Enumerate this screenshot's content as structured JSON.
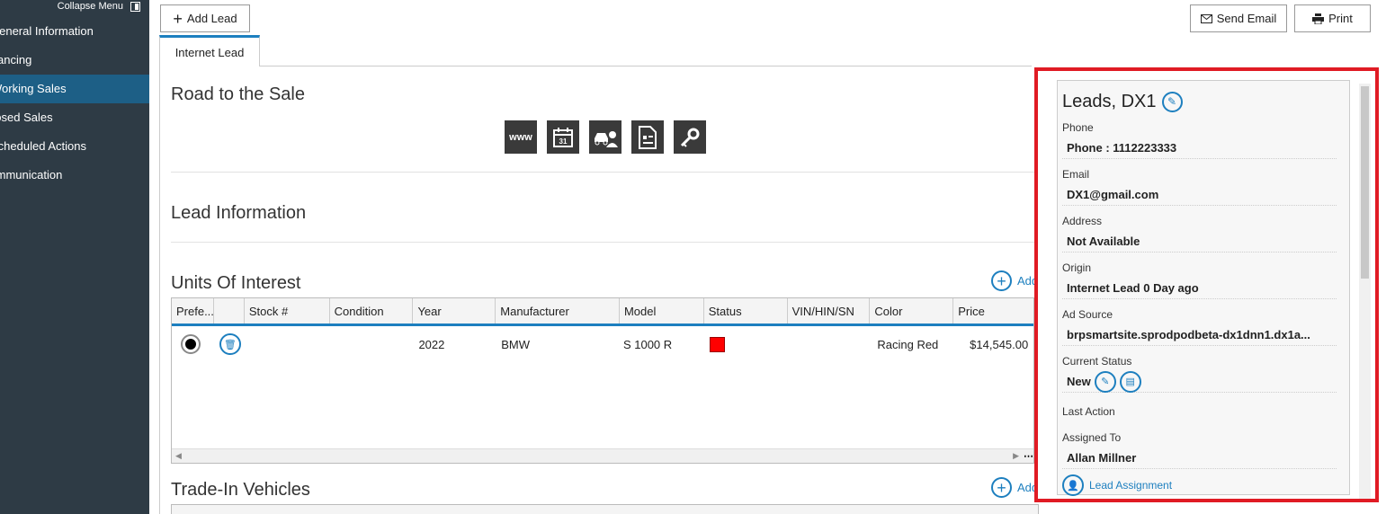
{
  "sidebar": {
    "collapse_label": "Collapse Menu",
    "items": [
      {
        "label": "General Information"
      },
      {
        "label": "Financing"
      },
      {
        "label": "Working Sales"
      },
      {
        "label": "Closed Sales"
      },
      {
        "label": "Scheduled Actions"
      },
      {
        "label": "Communication"
      }
    ]
  },
  "toolbar": {
    "add_lead": "Add Lead",
    "send_email": "Send Email",
    "print": "Print"
  },
  "tabs": {
    "internet_lead": "Internet Lead"
  },
  "road": {
    "title": "Road to the Sale",
    "icons": [
      "www-icon",
      "calendar-icon",
      "vehicle-person-icon",
      "document-icon",
      "key-icon"
    ],
    "www_text": "www",
    "cal_text": "31"
  },
  "lead_info": {
    "title": "Lead Information"
  },
  "units": {
    "title": "Units Of Interest",
    "add_label": "Add",
    "columns": [
      "Prefe...",
      "",
      "Stock #",
      "Condition",
      "Year",
      "Manufacturer",
      "Model",
      "Status",
      "VIN/HIN/SN",
      "Color",
      "Price"
    ],
    "rows": [
      {
        "stock": "",
        "condition": "",
        "year": "2022",
        "manufacturer": "BMW",
        "model": "S 1000 R",
        "status_color": "#ff0000",
        "vin": "",
        "color": "Racing Red",
        "price": "$14,545.00"
      }
    ]
  },
  "tradein": {
    "title": "Trade-In Vehicles",
    "add_label": "Add"
  },
  "panel": {
    "name": "Leads, DX1",
    "phone_label": "Phone",
    "phone_value": "Phone : 1112223333",
    "email_label": "Email",
    "email_value": "DX1@gmail.com",
    "address_label": "Address",
    "address_value": "Not Available",
    "origin_label": "Origin",
    "origin_value": "Internet Lead 0 Day ago",
    "adsource_label": "Ad Source",
    "adsource_value": "brpsmartsite.sprodpodbeta-dx1dnn1.dx1a...",
    "status_label": "Current Status",
    "status_value": "New",
    "lastaction_label": "Last Action",
    "assigned_label": "Assigned To",
    "assigned_value": "Allan Millner",
    "assignment_link": "Lead Assignment"
  },
  "colors": {
    "sidebar": "#2e3b45",
    "active": "#1d5f86",
    "accent": "#1d7fbf",
    "highlight_border": "#e01b24"
  }
}
